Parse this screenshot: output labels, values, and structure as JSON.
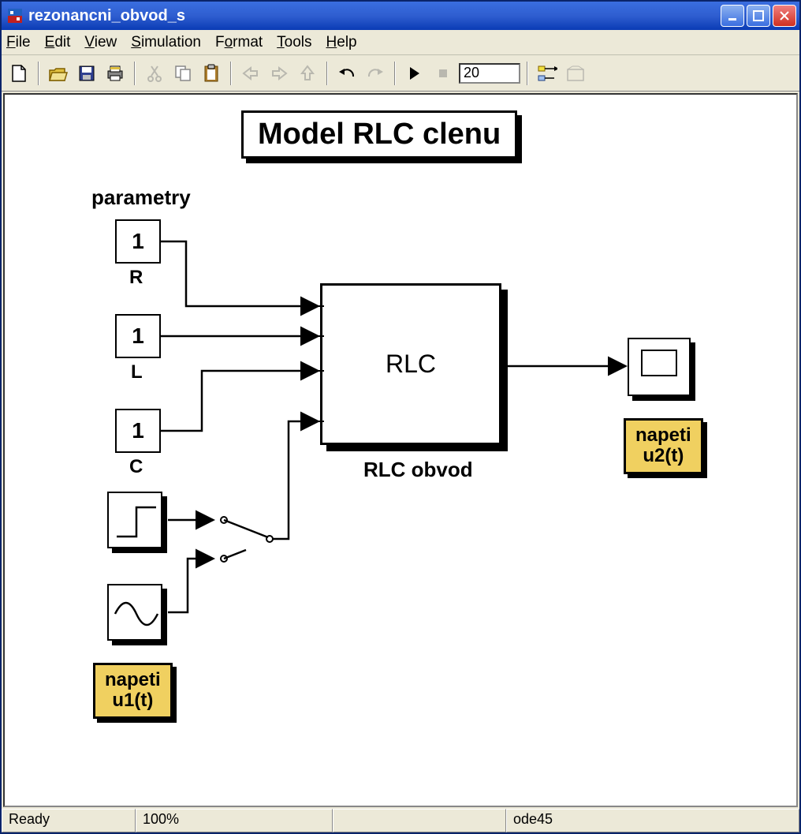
{
  "window": {
    "title": "rezonancni_obvod_s"
  },
  "menu": {
    "file": "File",
    "edit": "Edit",
    "view": "View",
    "simulation": "Simulation",
    "format": "Format",
    "tools": "Tools",
    "help": "Help"
  },
  "toolbar": {
    "stop_time": "20"
  },
  "canvas": {
    "title": "Model RLC clenu",
    "params_heading": "parametry",
    "const_R_value": "1",
    "const_R_label": "R",
    "const_L_value": "1",
    "const_L_label": "L",
    "const_C_value": "1",
    "const_C_label": "C",
    "rlc_text": "RLC",
    "rlc_label": "RLC obvod",
    "u1_tag_line1": "napeti",
    "u1_tag_line2": "u1(t)",
    "u2_tag_line1": "napeti",
    "u2_tag_line2": "u2(t)"
  },
  "status": {
    "ready": "Ready",
    "zoom": "100%",
    "mid": "",
    "solver": "ode45"
  }
}
